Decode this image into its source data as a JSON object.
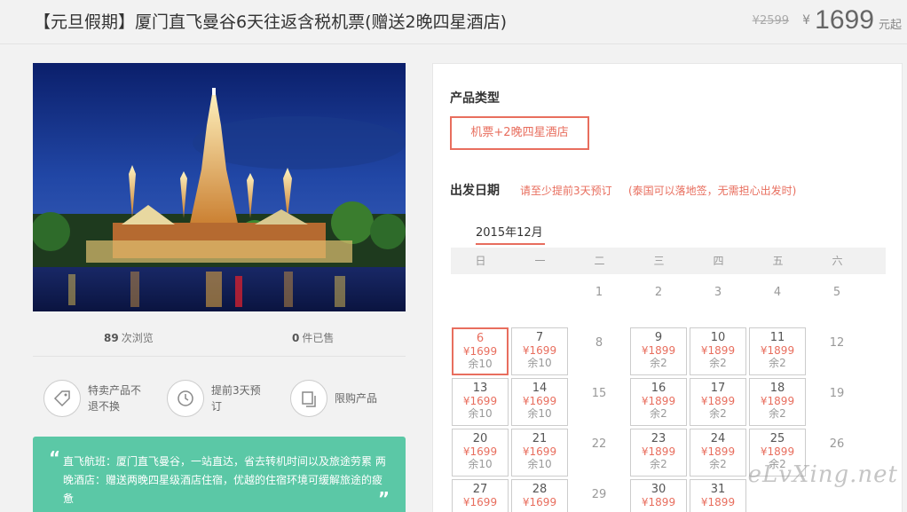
{
  "header": {
    "title": "【元旦假期】厦门直飞曼谷6天往返含税机票(赠送2晚四星酒店)",
    "original_price": "¥2599",
    "currency": "¥",
    "price": "1699",
    "price_suffix": "元起"
  },
  "stats": {
    "views_count": "89",
    "views_label": "次浏览",
    "sold_count": "0",
    "sold_label": "件已售"
  },
  "features": [
    {
      "icon": "tag-icon",
      "label": "特卖产品不退不换"
    },
    {
      "icon": "clock-icon",
      "label": "提前3天预订"
    },
    {
      "icon": "copy-icon",
      "label": "限购产品"
    }
  ],
  "promo": {
    "text": "直飞航班：厦门直飞曼谷，一站直达，省去转机时间以及旅途劳累 两晚酒店：赠送两晚四星级酒店住宿，优越的住宿环境可缓解旅途的疲惫",
    "quote_open": "“",
    "quote_close": "”"
  },
  "booking": {
    "product_type_title": "产品类型",
    "product_type_option": "机票+2晚四星酒店",
    "departure_title": "出发日期",
    "note_advance": "请至少提前3天预订",
    "note_visa": "(泰国可以落地签，无需担心出发时)",
    "month": "2015年12月",
    "weekdays": [
      "日",
      "一",
      "二",
      "三",
      "四",
      "五",
      "六"
    ]
  },
  "calendar": [
    {
      "day": "1",
      "col": 2,
      "row": 0
    },
    {
      "day": "2",
      "col": 3,
      "row": 0
    },
    {
      "day": "3",
      "col": 4,
      "row": 0
    },
    {
      "day": "4",
      "col": 5,
      "row": 0
    },
    {
      "day": "5",
      "col": 6,
      "row": 0
    },
    {
      "day": "6",
      "col": 0,
      "row": 1,
      "price": "¥1699",
      "remain": "余10",
      "selected": true
    },
    {
      "day": "7",
      "col": 1,
      "row": 1,
      "price": "¥1699",
      "remain": "余10"
    },
    {
      "day": "8",
      "col": 2,
      "row": 1
    },
    {
      "day": "9",
      "col": 3,
      "row": 1,
      "price": "¥1899",
      "remain": "余2"
    },
    {
      "day": "10",
      "col": 4,
      "row": 1,
      "price": "¥1899",
      "remain": "余2"
    },
    {
      "day": "11",
      "col": 5,
      "row": 1,
      "price": "¥1899",
      "remain": "余2"
    },
    {
      "day": "12",
      "col": 6,
      "row": 1
    },
    {
      "day": "13",
      "col": 0,
      "row": 2,
      "price": "¥1699",
      "remain": "余10"
    },
    {
      "day": "14",
      "col": 1,
      "row": 2,
      "price": "¥1699",
      "remain": "余10"
    },
    {
      "day": "15",
      "col": 2,
      "row": 2
    },
    {
      "day": "16",
      "col": 3,
      "row": 2,
      "price": "¥1899",
      "remain": "余2"
    },
    {
      "day": "17",
      "col": 4,
      "row": 2,
      "price": "¥1899",
      "remain": "余2"
    },
    {
      "day": "18",
      "col": 5,
      "row": 2,
      "price": "¥1899",
      "remain": "余2"
    },
    {
      "day": "19",
      "col": 6,
      "row": 2
    },
    {
      "day": "20",
      "col": 0,
      "row": 3,
      "price": "¥1699",
      "remain": "余10"
    },
    {
      "day": "21",
      "col": 1,
      "row": 3,
      "price": "¥1699",
      "remain": "余10"
    },
    {
      "day": "22",
      "col": 2,
      "row": 3
    },
    {
      "day": "23",
      "col": 3,
      "row": 3,
      "price": "¥1899",
      "remain": "余2"
    },
    {
      "day": "24",
      "col": 4,
      "row": 3,
      "price": "¥1899",
      "remain": "余2"
    },
    {
      "day": "25",
      "col": 5,
      "row": 3,
      "price": "¥1899",
      "remain": "余2"
    },
    {
      "day": "26",
      "col": 6,
      "row": 3
    },
    {
      "day": "27",
      "col": 0,
      "row": 4,
      "price": "¥1699"
    },
    {
      "day": "28",
      "col": 1,
      "row": 4,
      "price": "¥1699"
    },
    {
      "day": "29",
      "col": 2,
      "row": 4
    },
    {
      "day": "30",
      "col": 3,
      "row": 4,
      "price": "¥1899"
    },
    {
      "day": "31",
      "col": 4,
      "row": 4,
      "price": "¥1899"
    }
  ],
  "watermark": "eLvXing.net",
  "colors": {
    "accent": "#e86e5e",
    "promo_bg": "#5bc8a6"
  }
}
